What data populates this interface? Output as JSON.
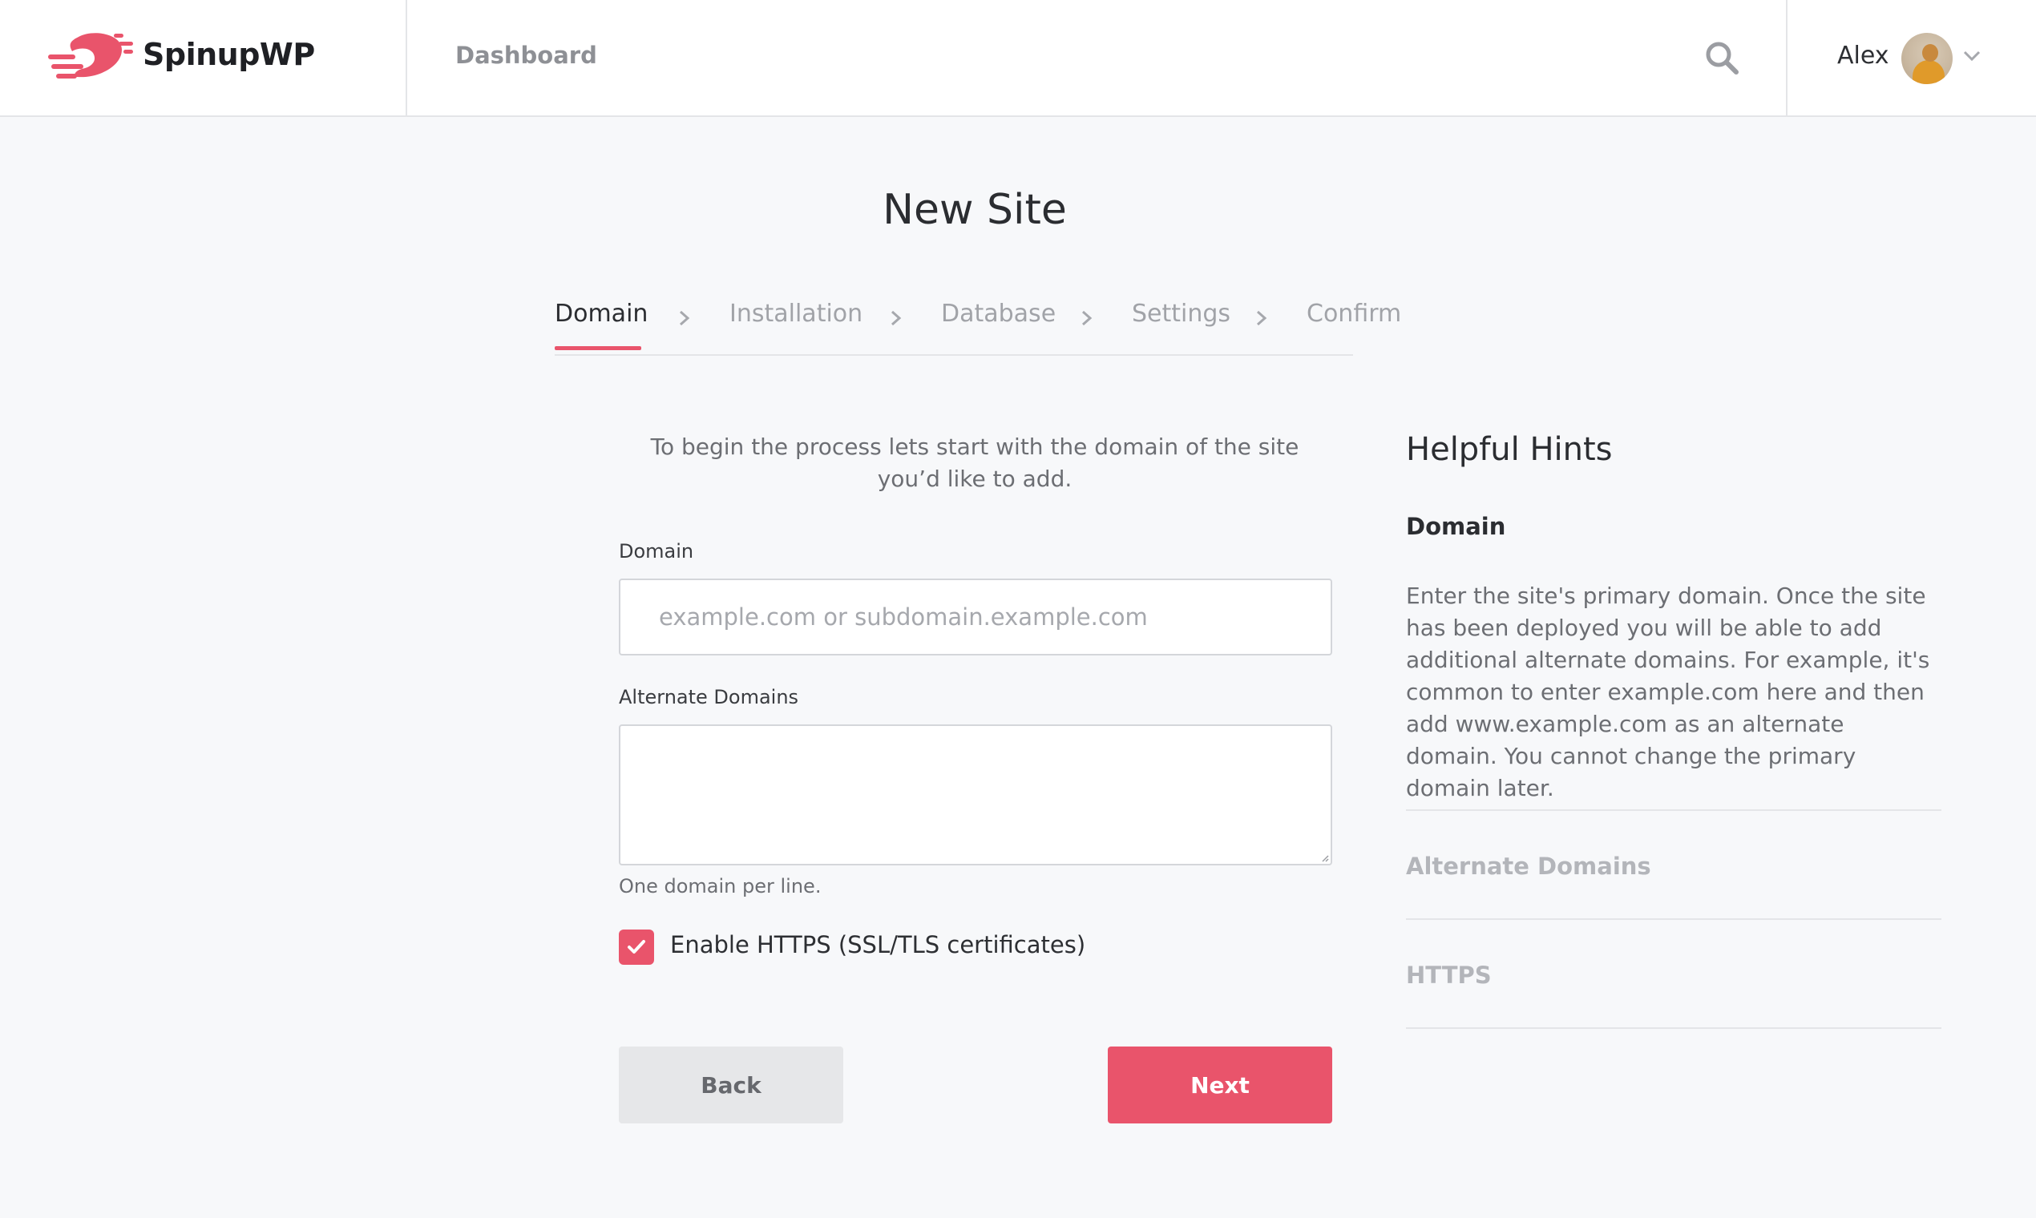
{
  "header": {
    "brand_name": "SpinupWP",
    "nav_dashboard": "Dashboard",
    "user_name": "Alex",
    "search_icon": "search-icon",
    "user_menu_icon": "chevron-down-icon"
  },
  "page": {
    "title": "New Site"
  },
  "steps": [
    {
      "label": "Domain",
      "active": true
    },
    {
      "label": "Installation",
      "active": false
    },
    {
      "label": "Database",
      "active": false
    },
    {
      "label": "Settings",
      "active": false
    },
    {
      "label": "Confirm",
      "active": false
    }
  ],
  "form": {
    "intro": "To begin the process lets start with the domain of the site you’d like to add.",
    "domain_label": "Domain",
    "domain_placeholder": "example.com or subdomain.example.com",
    "domain_value": "",
    "alternate_label": "Alternate Domains",
    "alternate_value": "",
    "alternate_help": "One domain per line.",
    "https_label": "Enable HTTPS (SSL/TLS certificates)",
    "https_checked": true,
    "back_label": "Back",
    "next_label": "Next"
  },
  "hints": {
    "title": "Helpful Hints",
    "domain_heading": "Domain",
    "domain_body": "Enter the site's primary domain. Once the site has been deployed you will be able to add additional alternate domains. For example, it's common to enter example.com here and then add www.example.com as an alternate domain. You cannot change the primary domain later.",
    "alternate_heading": "Alternate Domains",
    "https_heading": "HTTPS"
  },
  "colors": {
    "accent": "#e9546b",
    "background": "#f7f8fa",
    "header_background": "#ffffff",
    "muted_text": "#6c6e73"
  }
}
